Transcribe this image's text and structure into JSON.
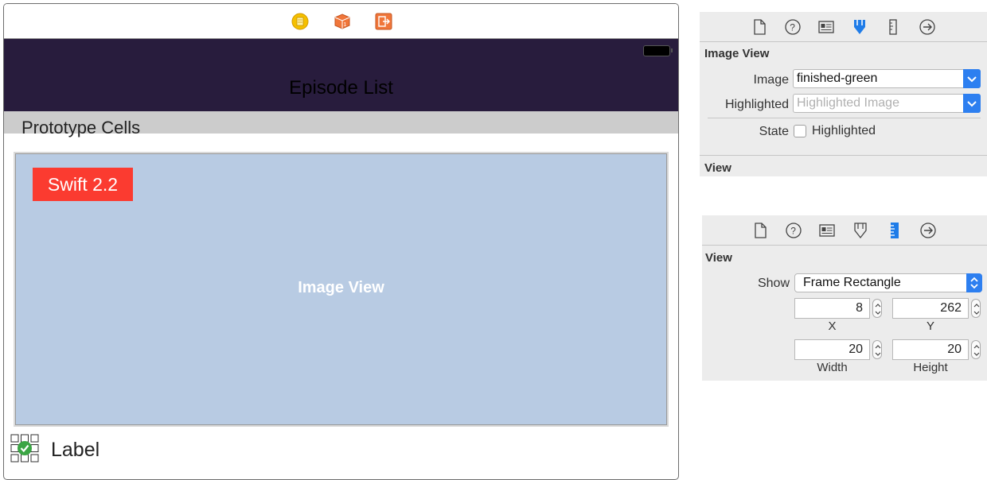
{
  "canvas": {
    "nav_title": "Episode List",
    "section_title": "Prototype Cells",
    "badge": "Swift 2.2",
    "image_view_placeholder": "Image View",
    "cell_label": "Label",
    "dock_icons": [
      "view-controller-icon",
      "first-responder-icon",
      "exit-icon"
    ],
    "colors": {
      "navbar": "#281c3d",
      "image_bg": "#b8cbe3",
      "badge": "#fb3b30"
    }
  },
  "attributes_inspector": {
    "tabs": [
      "file-icon",
      "help-icon",
      "identity-icon",
      "attributes-icon",
      "size-icon",
      "connections-icon"
    ],
    "active_tab": "attributes-icon",
    "section": "Image View",
    "image_label": "Image",
    "image_value": "finished-green",
    "highlighted_label": "Highlighted",
    "highlighted_placeholder": "Highlighted Image",
    "state_label": "State",
    "state_checkbox_label": "Highlighted",
    "state_checked": false,
    "view_section": "View"
  },
  "size_inspector": {
    "tabs": [
      "file-icon",
      "help-icon",
      "identity-icon",
      "attributes-icon",
      "size-icon",
      "connections-icon"
    ],
    "active_tab": "size-icon",
    "section": "View",
    "show_label": "Show",
    "show_value": "Frame Rectangle",
    "x": "8",
    "x_label": "X",
    "y": "262",
    "y_label": "Y",
    "width": "20",
    "width_label": "Width",
    "height": "20",
    "height_label": "Height"
  }
}
